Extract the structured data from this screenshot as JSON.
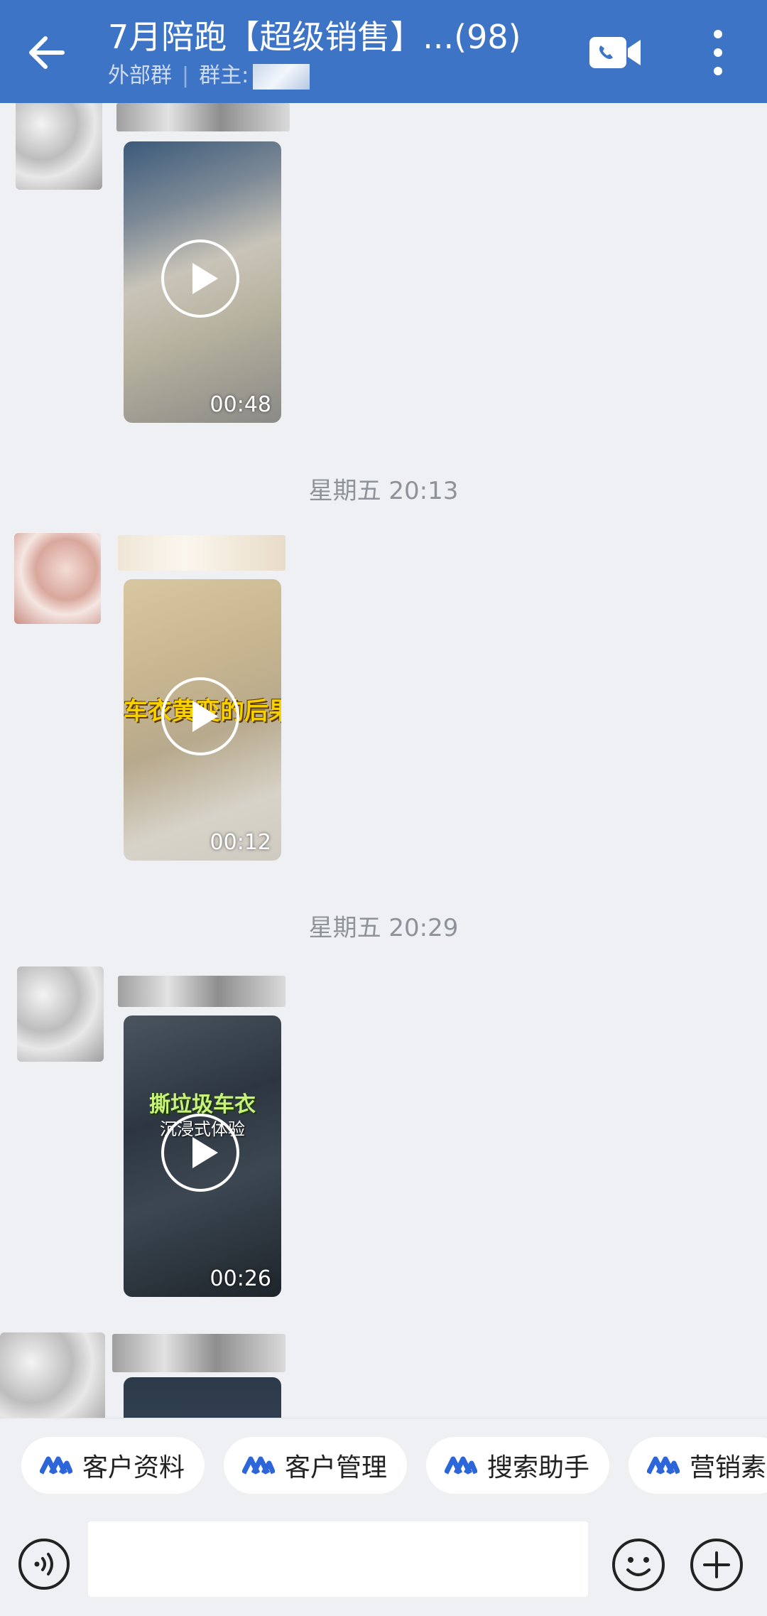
{
  "header": {
    "title": "7月陪跑【超级销售】...(98)",
    "group_type": "外部群",
    "owner_label": "群主:"
  },
  "messages": [
    {
      "duration": "00:48",
      "overlay": "",
      "overlay_sub": ""
    },
    {
      "timestamp": "星期五  20:13",
      "duration": "00:12",
      "overlay": "车衣黄变的后果",
      "overlay_sub": ""
    },
    {
      "timestamp": "星期五  20:29",
      "duration": "00:26",
      "overlay": "撕垃圾车衣",
      "overlay_sub": "沉浸式体验"
    },
    {
      "duration": ""
    }
  ],
  "quick_actions": [
    {
      "label": "客户资料",
      "icon": "chevron-logo-icon"
    },
    {
      "label": "客户管理",
      "icon": "chevron-logo-icon"
    },
    {
      "label": "搜索助手",
      "icon": "chevron-logo-icon"
    },
    {
      "label": "营销素",
      "icon": "chevron-logo-icon"
    }
  ],
  "input": {
    "value": "",
    "placeholder": ""
  },
  "colors": {
    "header": "#3e74c6",
    "accent": "#2c66d8",
    "background": "#eef0f4"
  }
}
